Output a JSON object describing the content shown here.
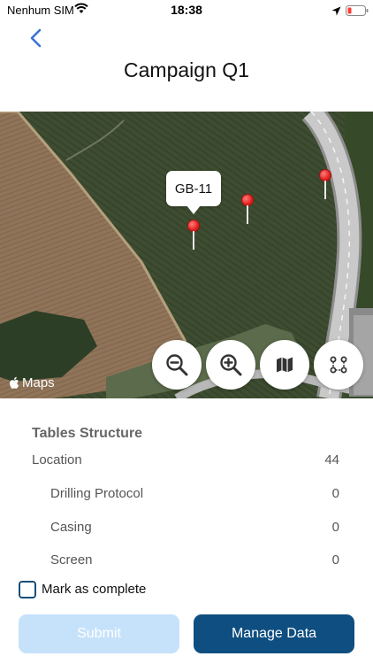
{
  "status_bar": {
    "carrier": "Nenhum SIM",
    "time": "18:38"
  },
  "header": {
    "title": "Campaign Q1"
  },
  "map": {
    "callout_label": "GB-11",
    "attribution": "Maps",
    "buttons": [
      "zoom-out-icon",
      "zoom-in-icon",
      "map-type-icon",
      "route-icon"
    ]
  },
  "tables_structure": {
    "title": "Tables Structure",
    "rows": [
      {
        "label": "Location",
        "count": "44"
      },
      {
        "label": "Drilling Protocol",
        "count": "0"
      },
      {
        "label": "Casing",
        "count": "0"
      },
      {
        "label": "Screen",
        "count": "0"
      }
    ]
  },
  "mark_complete": {
    "label": "Mark as complete"
  },
  "actions": {
    "submit_label": "Submit",
    "manage_label": "Manage Data"
  },
  "colors": {
    "accent": "#0f4e80",
    "submit_disabled": "#c6e2fb",
    "pin": "#e0221f"
  }
}
